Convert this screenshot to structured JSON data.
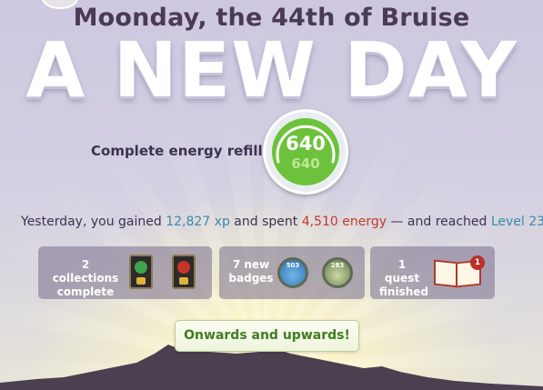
{
  "header": {
    "date": "Moonday, the 44th of Bruise",
    "headline": "A NEW DAY"
  },
  "energy": {
    "label": "Complete energy refill",
    "current": "640",
    "max": "640",
    "fill_fraction": 1.0,
    "ring_color": "#6cc23a"
  },
  "summary": {
    "prefix": "Yesterday, you gained ",
    "xp": "12,827 xp",
    "mid": " and spent ",
    "energy": "4,510 energy",
    "dash": " — and reached ",
    "level": "Level 23"
  },
  "panels": {
    "collections": {
      "text": "2 collections complete",
      "line1": "2 collections",
      "line2": "complete"
    },
    "badges": {
      "line1": "7 new",
      "line2": "badges",
      "badge1": "503",
      "badge2": "283"
    },
    "quests": {
      "line1": "1 quest",
      "line2": "finished",
      "count": "1"
    }
  },
  "cta": {
    "label": "Onwards and upwards!"
  },
  "colors": {
    "title": "#4a3a58",
    "xp": "#3a8aa8",
    "energy_spent": "#c0392b",
    "cta_text": "#3f7d22"
  }
}
